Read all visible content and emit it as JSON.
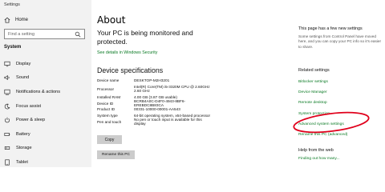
{
  "window": {
    "title": "Settings"
  },
  "sidebar": {
    "home_label": "Home",
    "search_placeholder": "Find a setting",
    "section_title": "System",
    "items": [
      {
        "label": "Display",
        "icon": "display-icon"
      },
      {
        "label": "Sound",
        "icon": "sound-icon"
      },
      {
        "label": "Notifications & actions",
        "icon": "notifications-icon"
      },
      {
        "label": "Focus assist",
        "icon": "focus-assist-icon"
      },
      {
        "label": "Power & sleep",
        "icon": "power-icon"
      },
      {
        "label": "Battery",
        "icon": "battery-icon"
      },
      {
        "label": "Storage",
        "icon": "storage-icon"
      },
      {
        "label": "Tablet",
        "icon": "tablet-icon"
      }
    ]
  },
  "main": {
    "title": "About",
    "protection_text": "Your PC is being monitored and protected.",
    "security_link": "See details in Windows Security",
    "device_specs_title": "Device specifications",
    "specs": [
      {
        "key": "Device name",
        "value": "DESKTOP-M2H3201"
      },
      {
        "key": "Processor",
        "value": "Intel(R) Core(TM) i5-3320M CPU @ 2.60GHz   2.60 GHz"
      },
      {
        "key": "Installed RAM",
        "value": "4.00 GB (3.87 GB usable)"
      },
      {
        "key": "Device ID",
        "value": "BCRB4A0C-D4F0-4943-8BF6-EREBDC8B83CA"
      },
      {
        "key": "Product ID",
        "value": "00331-10000-00001-AA543"
      },
      {
        "key": "System type",
        "value": "64-bit operating system, x64-based processor"
      },
      {
        "key": "Pen and touch",
        "value": "No pen or touch input is available for this display"
      }
    ],
    "copy_label": "Copy",
    "rename_label": "Rename this PC"
  },
  "right": {
    "heading": "This page has a few new settings",
    "description": "Some settings from Control Panel have moved here, and you can copy your PC info so it's easier to share.",
    "related_title": "Related settings",
    "links": [
      "Bitlocker settings",
      "Device Manager",
      "Remote desktop",
      "System protection",
      "Advanced system settings",
      "Rename this PC (advanced)"
    ],
    "help_title": "Help from the web",
    "help_link": "Finding out how many..."
  },
  "colors": {
    "accent_link": "#0a7a24",
    "sidebar_bg": "#f2f2f2",
    "annotation_circle": "#e0001b"
  }
}
